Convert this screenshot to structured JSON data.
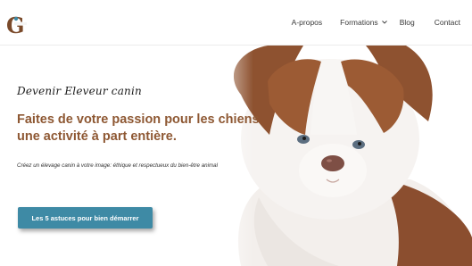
{
  "brand": {
    "logo_letter": "G"
  },
  "nav": {
    "items": [
      {
        "label": "A-propos"
      },
      {
        "label": "Formations"
      },
      {
        "label": "Blog"
      },
      {
        "label": "Contact"
      }
    ]
  },
  "hero": {
    "script_title": "Devenir Eleveur canin",
    "headline_line1": "Faites de votre passion pour les chiens",
    "headline_line2": "une activité à part entière.",
    "subline": "Créez un élevage canin à votre image: éthique et respectueux du bien-être animal",
    "cta_label": "Les 5 astuces pour bien démarrer"
  },
  "colors": {
    "accent_brown": "#8e5833",
    "button_blue": "#3e8aa5",
    "nav_text": "#3a3a3a"
  }
}
